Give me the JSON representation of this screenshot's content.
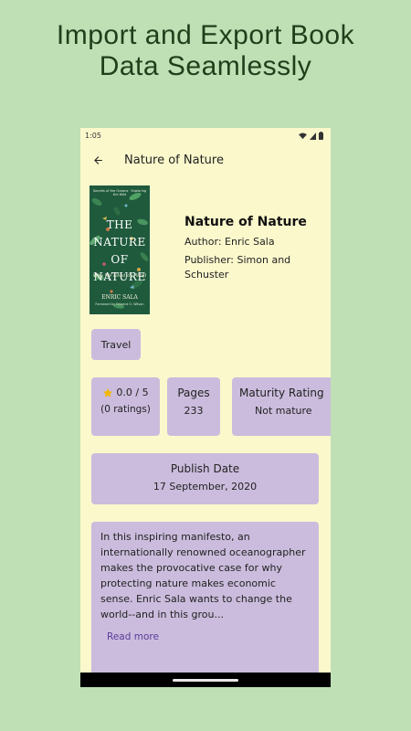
{
  "promo": {
    "headline_line1": "Import and Export Book",
    "headline_line2": "Data Seamlessly"
  },
  "status_bar": {
    "time": "1:05",
    "icons": [
      "wifi-icon",
      "signal-icon",
      "battery-icon"
    ]
  },
  "app_bar": {
    "back_icon": "arrow-back-icon",
    "title": "Nature of Nature"
  },
  "cover": {
    "top_text": "Secrets of the Oceans · Exploring the Wild",
    "title_line1": "THE",
    "title_line2": "NATURE",
    "title_line3": "OF",
    "title_line4": "NATURE",
    "subtitle": "Why We Need the Wild",
    "author": "ENRIC SALA",
    "byline": "Foreword by Edward O. Wilson"
  },
  "book": {
    "title": "Nature of Nature",
    "author_line": "Author: Enric Sala",
    "publisher_line": "Publisher: Simon and Schuster"
  },
  "category_chip": "Travel",
  "stats": {
    "rating_value": "0.0 / 5",
    "rating_count": "(0 ratings)",
    "rating_icon": "star-icon",
    "pages_label": "Pages",
    "pages_value": "233",
    "maturity_label": "Maturity Rating",
    "maturity_value": "Not mature"
  },
  "publish": {
    "label": "Publish Date",
    "value": "17 September, 2020"
  },
  "description": {
    "text": "In this inspiring manifesto, an internationally renowned oceanographer makes the provocative case for why protecting nature makes economic sense. Enric Sala wants to change the world--and in this grou...",
    "read_more": "Read more"
  },
  "colors": {
    "background": "#bfe0b5",
    "screen": "#fbf8cc",
    "card": "#cbbcdd",
    "accent": "#5a3c99",
    "headline": "#1e3f1a"
  }
}
